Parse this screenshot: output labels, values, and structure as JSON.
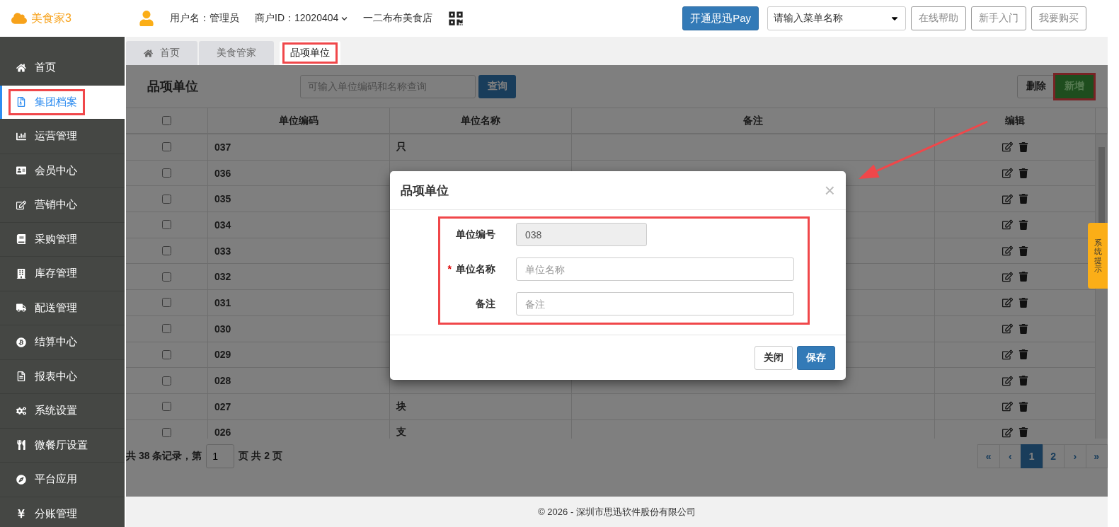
{
  "header": {
    "logo_text": "美食家3",
    "user_label": "用户名：管理员",
    "merchant_label": "商户ID：12020404",
    "store_name": "一二布布美食店",
    "pay_button": "开通思迅Pay",
    "menu_search": {
      "placeholder": "请输入菜单名称"
    },
    "buttons": [
      "在线帮助",
      "新手入门",
      "我要购买"
    ]
  },
  "sidebar": {
    "items": [
      {
        "label": "首页",
        "selected": false,
        "highlighted": false
      },
      {
        "label": "集团档案",
        "selected": true,
        "highlighted": true
      },
      {
        "label": "运营管理",
        "selected": false,
        "highlighted": false
      },
      {
        "label": "会员中心",
        "selected": false,
        "highlighted": false
      },
      {
        "label": "营销中心",
        "selected": false,
        "highlighted": false
      },
      {
        "label": "采购管理",
        "selected": false,
        "highlighted": false
      },
      {
        "label": "库存管理",
        "selected": false,
        "highlighted": false
      },
      {
        "label": "配送管理",
        "selected": false,
        "highlighted": false
      },
      {
        "label": "结算中心",
        "selected": false,
        "highlighted": false
      },
      {
        "label": "报表中心",
        "selected": false,
        "highlighted": false
      },
      {
        "label": "系统设置",
        "selected": false,
        "highlighted": false
      },
      {
        "label": "微餐厅设置",
        "selected": false,
        "highlighted": false
      },
      {
        "label": "平台应用",
        "selected": false,
        "highlighted": false
      },
      {
        "label": "分账管理",
        "selected": false,
        "highlighted": false
      }
    ]
  },
  "tabs": [
    {
      "label": "首页",
      "selected": false,
      "highlighted": false,
      "kind": "home"
    },
    {
      "label": "美食管家",
      "selected": false,
      "highlighted": false,
      "kind": "plain"
    },
    {
      "label": "品项单位",
      "selected": true,
      "highlighted": true,
      "kind": "plain"
    }
  ],
  "page": {
    "title": "品项单位",
    "search": {
      "placeholder": "可输入单位编码和名称查询"
    },
    "search_button": "查询",
    "actions": [
      {
        "label": "删除",
        "kind": "default",
        "highlighted": false
      },
      {
        "label": "新增",
        "kind": "success",
        "highlighted": true
      }
    ]
  },
  "table": {
    "select_all": {
      "checked": false
    },
    "columns": [
      "单位编码",
      "单位名称",
      "备注",
      "编辑"
    ],
    "rows": [
      {
        "code": "037",
        "name": "只",
        "checked": false
      },
      {
        "code": "036",
        "checked": false
      },
      {
        "code": "035",
        "checked": false
      },
      {
        "code": "034",
        "checked": false
      },
      {
        "code": "033",
        "checked": false
      },
      {
        "code": "032",
        "checked": false
      },
      {
        "code": "031",
        "checked": false
      },
      {
        "code": "030",
        "checked": false
      },
      {
        "code": "029",
        "checked": false
      },
      {
        "code": "028",
        "checked": false
      },
      {
        "code": "027",
        "name": "块",
        "checked": false
      },
      {
        "code": "026",
        "name": "支",
        "checked": false
      }
    ]
  },
  "pagination": {
    "summary_prefix": "共 38 条记录，第",
    "page_input": "1",
    "summary_suffix": "页 共 2 页",
    "pages": [
      {
        "label": "«",
        "selected": false
      },
      {
        "label": "‹",
        "selected": false
      },
      {
        "label": "1",
        "selected": true
      },
      {
        "label": "2",
        "selected": false
      },
      {
        "label": "›",
        "selected": false
      },
      {
        "label": "»",
        "selected": false
      }
    ]
  },
  "dialog": {
    "title": "品项单位",
    "close": "×",
    "highlighted": true,
    "fields": [
      {
        "label": "单位编号",
        "required": false,
        "disabled": true,
        "value": "038"
      },
      {
        "label": "单位名称",
        "required": true,
        "disabled": false,
        "placeholder": "单位名称"
      },
      {
        "label": "备注",
        "required": false,
        "disabled": false,
        "placeholder": "备注"
      }
    ],
    "required_mark": "*",
    "buttons": [
      {
        "label": "关闭",
        "kind": "default"
      },
      {
        "label": "保存",
        "kind": "primary"
      }
    ]
  },
  "side_tab": "系统提示",
  "footer": "© 2026 - 深圳市思迅软件股份有限公司"
}
